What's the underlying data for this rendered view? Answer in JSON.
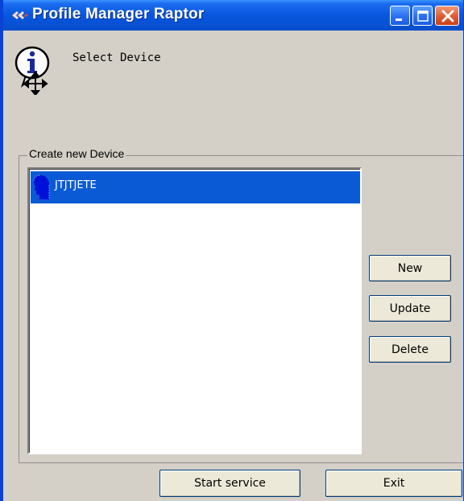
{
  "window": {
    "title": "Profile Manager Raptor"
  },
  "header": {
    "text": "Select Device"
  },
  "group": {
    "label": "Create new Device"
  },
  "devices": [
    {
      "name": "JTJTJETE",
      "selected": true
    }
  ],
  "buttons": {
    "new": "New",
    "update": "Update",
    "delete": "Delete",
    "start_service": "Start service",
    "exit": "Exit"
  },
  "colors": {
    "titlebar": "#0a58e0",
    "selection": "#0a5ad6",
    "dialog_bg": "#d4d0c8"
  }
}
